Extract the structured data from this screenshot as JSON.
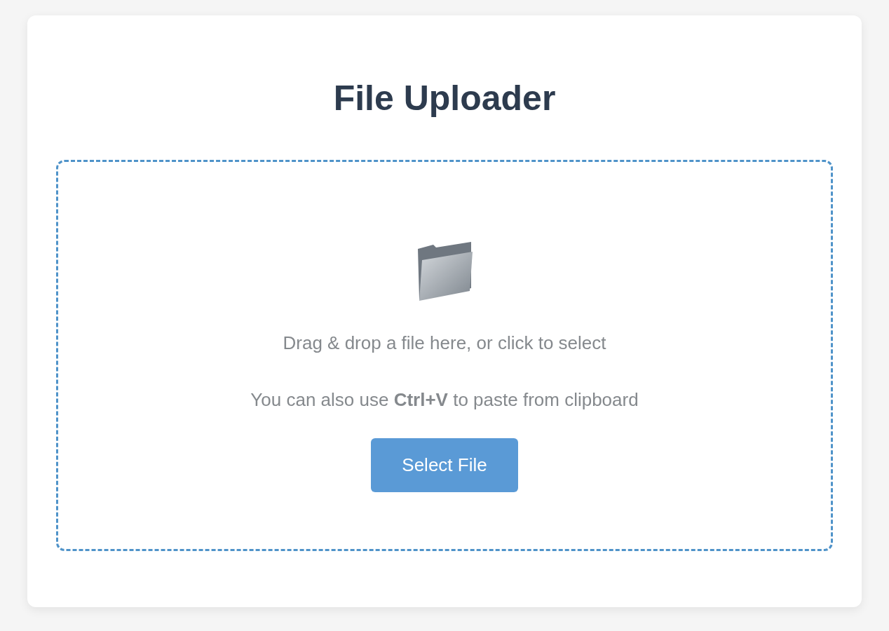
{
  "title": "File Uploader",
  "dropzone": {
    "instruction": "Drag & drop a file here, or click to select",
    "hint": "You can also use **Ctrl+V** to paste from clipboard",
    "button": "Select File"
  }
}
